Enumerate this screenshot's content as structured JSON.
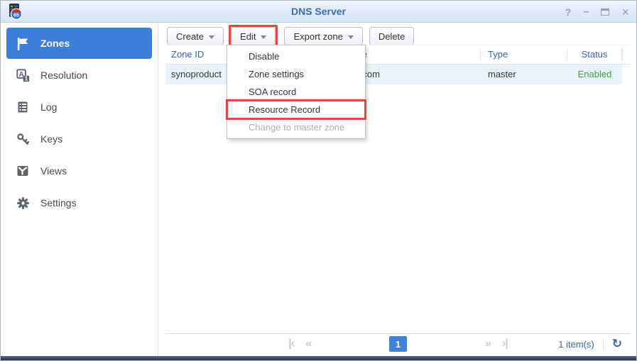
{
  "window": {
    "title": "DNS Server",
    "controls": {
      "help": "?",
      "minimize": "–",
      "close": "×"
    }
  },
  "sidebar": {
    "items": [
      {
        "label": "Zones",
        "icon": "flag-icon",
        "selected": true
      },
      {
        "label": "Resolution",
        "icon": "translate-icon",
        "selected": false
      },
      {
        "label": "Log",
        "icon": "log-list-icon",
        "selected": false
      },
      {
        "label": "Keys",
        "icon": "key-icon",
        "selected": false
      },
      {
        "label": "Views",
        "icon": "views-icon",
        "selected": false
      },
      {
        "label": "Settings",
        "icon": "gear-icon",
        "selected": false
      }
    ]
  },
  "toolbar": {
    "create_label": "Create",
    "edit_label": "Edit",
    "export_label": "Export zone",
    "delete_label": "Delete"
  },
  "edit_menu": {
    "items": [
      {
        "label": "Disable",
        "disabled": false,
        "annotated": false
      },
      {
        "label": "Zone settings",
        "disabled": false,
        "annotated": false
      },
      {
        "label": "SOA record",
        "disabled": false,
        "annotated": false
      },
      {
        "label": "Resource Record",
        "disabled": false,
        "annotated": true
      },
      {
        "label": "Change to master zone",
        "disabled": true,
        "annotated": false
      }
    ]
  },
  "table": {
    "columns": [
      "Zone ID",
      "Domain name",
      "Type",
      "Status"
    ],
    "rows": [
      {
        "zone_id": "synoproduct",
        "domain": "synoproduct.com",
        "type": "master",
        "status": "Enabled"
      }
    ]
  },
  "pagination": {
    "current_page": "1",
    "items_label": "1 item(s)"
  },
  "colors": {
    "accent_blue": "#3d7edb",
    "header_blue": "#3566b0",
    "status_green": "#3fa13a",
    "annotation_red": "#e5483c",
    "titlebar_gradient_top": "#eef5fc",
    "titlebar_gradient_bottom": "#d2e2f4",
    "row_highlight": "#e8f3fc"
  }
}
